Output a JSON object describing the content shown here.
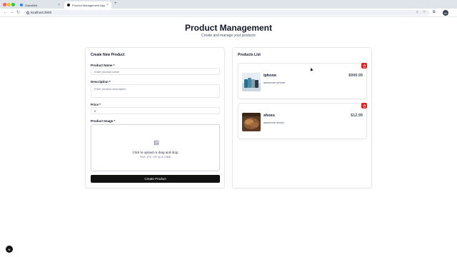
{
  "browser": {
    "tabs": [
      {
        "label": "StackBlitz",
        "active": false
      },
      {
        "label": "Product Management App",
        "active": true
      }
    ],
    "url": "localhost:3000",
    "profile_initial": "M"
  },
  "page": {
    "title": "Product Management",
    "subtitle": "Create and manage your products"
  },
  "form": {
    "title": "Create New Product",
    "name_label": "Product Name *",
    "name_placeholder": "Enter product name",
    "description_label": "Description *",
    "description_placeholder": "Enter product description",
    "price_label": "Price *",
    "price_value": "0",
    "image_label": "Product Image *",
    "upload_text": "Click to upload or drag and drop",
    "upload_hint": "PNG, JPG, GIF up to 10MB",
    "submit_label": "Create Product"
  },
  "products": {
    "title": "Products List",
    "items": [
      {
        "name": "iphone",
        "description": "awesome iphone",
        "price": "$999.99"
      },
      {
        "name": "shoes",
        "description": "awesome shoes",
        "price": "$12.99"
      }
    ]
  },
  "floating_button": {
    "label": "N"
  },
  "colors": {
    "accent": "#111111",
    "danger": "#dc2626"
  }
}
